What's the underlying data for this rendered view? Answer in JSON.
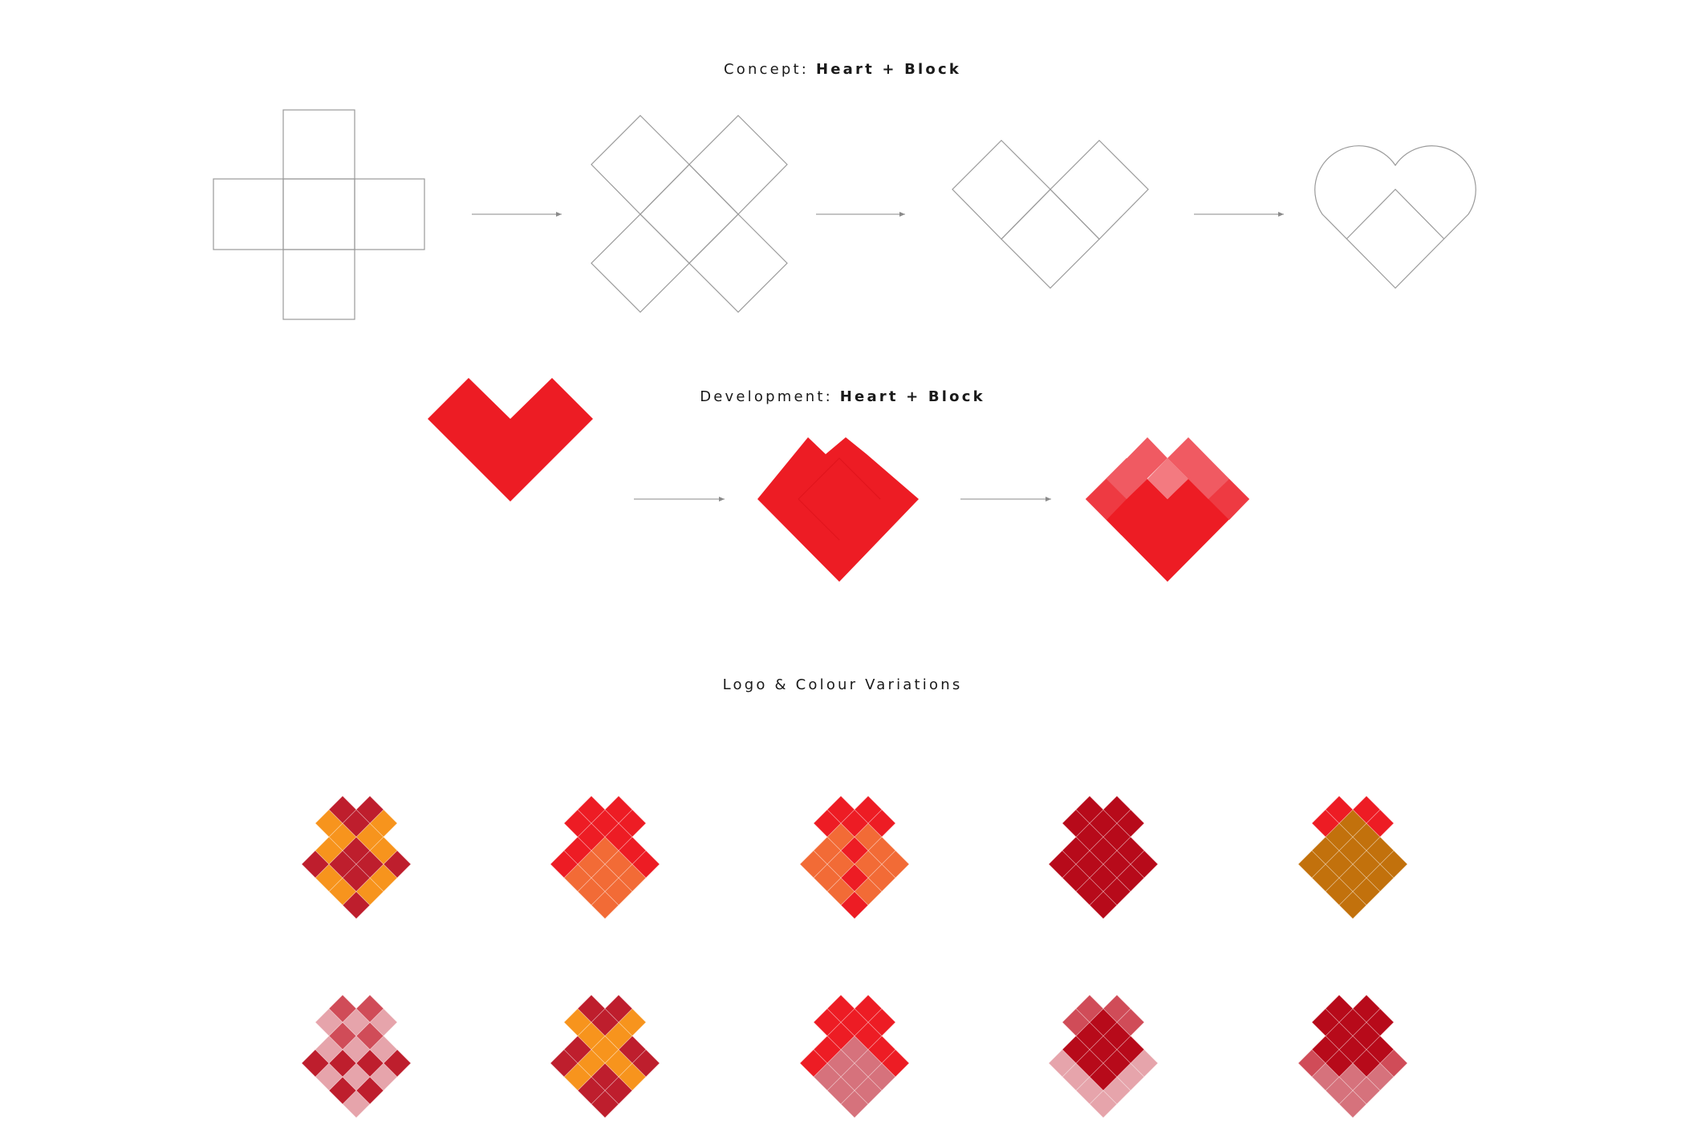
{
  "sections": {
    "concept": {
      "prefix": "Concept: ",
      "bold": "Heart + Block"
    },
    "development": {
      "prefix": "Development: ",
      "bold": "Heart + Block"
    },
    "variations": {
      "title": "Logo & Colour Variations"
    }
  },
  "colors": {
    "outline": "#9a9a9a",
    "arrow": "#8a8a8a",
    "red": "#ed1c24",
    "light_red": "#f05a62",
    "lighter_red": "#f37a80",
    "crimson": "#be1e2d",
    "dark_red": "#b70a1a",
    "orange": "#f7941d",
    "dark_orange": "#f26b36",
    "mustard": "#c2710c",
    "pink": "#d6727c",
    "light_pink": "#e6a4ab",
    "mid_pink": "#d04c58"
  },
  "logo_variations": [
    {
      "name": "crimson-orange-cross",
      "left": "crimson-orange",
      "right": "crimson-orange"
    },
    {
      "name": "red-orange-lower",
      "left": "red-orange-lower",
      "right": "red-orange-lower"
    },
    {
      "name": "orange-red-chevron",
      "left": "orange-red-chevron",
      "right": "orange-red-chevron"
    },
    {
      "name": "dark-red-solid",
      "left": "solid-dark",
      "right": "solid-dark"
    },
    {
      "name": "red-mustard",
      "left": "red-mustard",
      "right": "red-mustard"
    },
    {
      "name": "pink-checker",
      "left": "pink-checker",
      "right": "pink-checker"
    },
    {
      "name": "crimson-orange-zigzag",
      "left": "crimson-zigzag",
      "right": "crimson-zigzag"
    },
    {
      "name": "red-pink",
      "left": "red-pink",
      "right": "red-pink"
    },
    {
      "name": "pink-dark-red",
      "left": "pinkedge-dark",
      "right": "pinkedge-dark"
    },
    {
      "name": "crimson-pink-base",
      "left": "crimson-pink",
      "right": "crimson-pink"
    }
  ]
}
